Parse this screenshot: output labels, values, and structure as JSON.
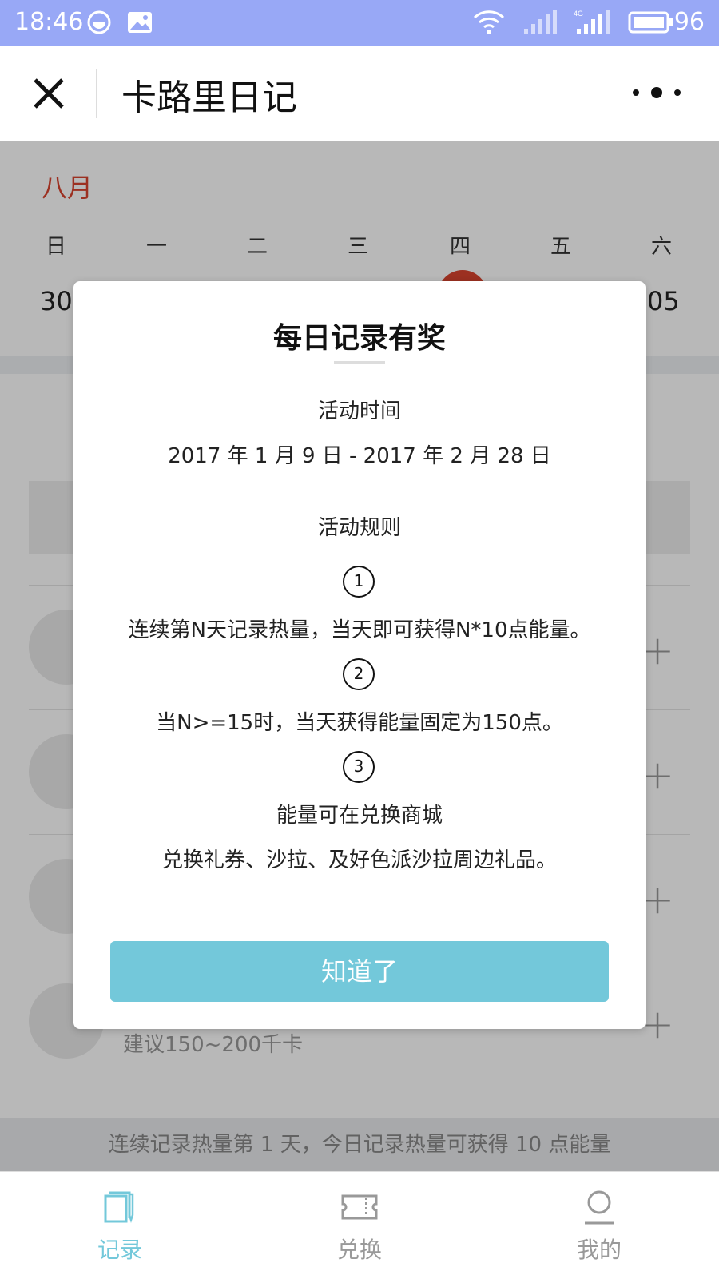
{
  "status_bar": {
    "time": "18:46",
    "battery": "96",
    "icons": [
      "notification-icon",
      "gallery-icon",
      "wifi-icon",
      "signal-icon",
      "4g-signal-icon",
      "battery-icon"
    ]
  },
  "nav": {
    "title": "卡路里日记"
  },
  "calendar": {
    "month": "八月",
    "weekdays": [
      "日",
      "一",
      "二",
      "三",
      "四",
      "五",
      "六"
    ],
    "first_date": "30",
    "last_date": "05"
  },
  "meals": {
    "snack_hint": "建议150~200千卡"
  },
  "footer_note": "连续记录热量第 1 天，今日记录热量可获得 10 点能量",
  "dialog": {
    "title": "每日记录有奖",
    "time_label": "活动时间",
    "time_range": "2017 年 1 月 9 日 - 2017 年 2 月 28 日",
    "rules_label": "活动规则",
    "rules": [
      {
        "num": "1",
        "text": "连续第N天记录热量，当天即可获得N*10点能量。"
      },
      {
        "num": "2",
        "text": "当N>=15时，当天获得能量固定为150点。"
      },
      {
        "num": "3",
        "text": "能量可在兑换商城"
      }
    ],
    "rule3_line2": "兑换礼券、沙拉、及好色派沙拉周边礼品。",
    "button": "知道了"
  },
  "tabs": [
    {
      "label": "记录",
      "icon": "notebook-icon",
      "active": true
    },
    {
      "label": "兑换",
      "icon": "ticket-icon",
      "active": false
    },
    {
      "label": "我的",
      "icon": "user-icon",
      "active": false
    }
  ],
  "colors": {
    "accent": "#73c8da",
    "month_red": "#d9432e",
    "status_bar": "#98a8f6"
  }
}
